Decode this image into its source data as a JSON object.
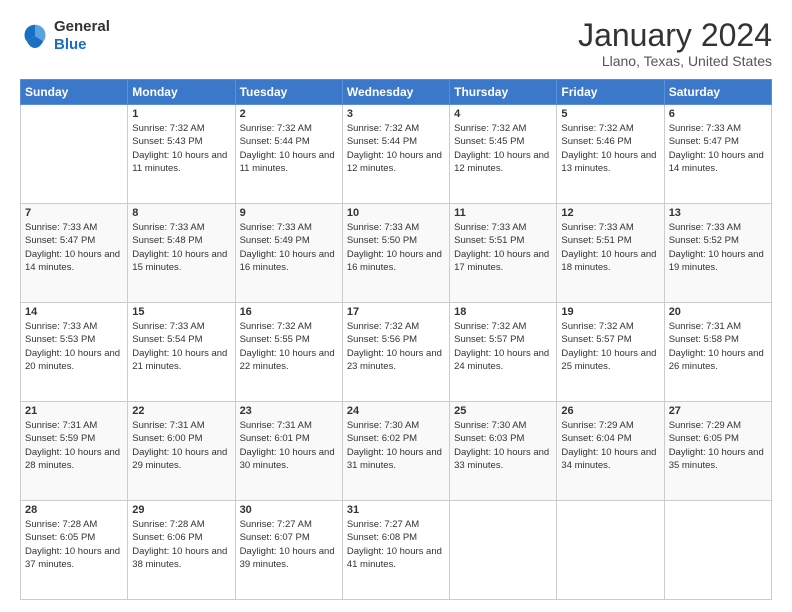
{
  "header": {
    "logo": {
      "general": "General",
      "blue": "Blue"
    },
    "title": "January 2024",
    "location": "Llano, Texas, United States"
  },
  "days_of_week": [
    "Sunday",
    "Monday",
    "Tuesday",
    "Wednesday",
    "Thursday",
    "Friday",
    "Saturday"
  ],
  "weeks": [
    [
      {
        "day": "",
        "sunrise": "",
        "sunset": "",
        "daylight": ""
      },
      {
        "day": "1",
        "sunrise": "Sunrise: 7:32 AM",
        "sunset": "Sunset: 5:43 PM",
        "daylight": "Daylight: 10 hours and 11 minutes."
      },
      {
        "day": "2",
        "sunrise": "Sunrise: 7:32 AM",
        "sunset": "Sunset: 5:44 PM",
        "daylight": "Daylight: 10 hours and 11 minutes."
      },
      {
        "day": "3",
        "sunrise": "Sunrise: 7:32 AM",
        "sunset": "Sunset: 5:44 PM",
        "daylight": "Daylight: 10 hours and 12 minutes."
      },
      {
        "day": "4",
        "sunrise": "Sunrise: 7:32 AM",
        "sunset": "Sunset: 5:45 PM",
        "daylight": "Daylight: 10 hours and 12 minutes."
      },
      {
        "day": "5",
        "sunrise": "Sunrise: 7:32 AM",
        "sunset": "Sunset: 5:46 PM",
        "daylight": "Daylight: 10 hours and 13 minutes."
      },
      {
        "day": "6",
        "sunrise": "Sunrise: 7:33 AM",
        "sunset": "Sunset: 5:47 PM",
        "daylight": "Daylight: 10 hours and 14 minutes."
      }
    ],
    [
      {
        "day": "7",
        "sunrise": "Sunrise: 7:33 AM",
        "sunset": "Sunset: 5:47 PM",
        "daylight": "Daylight: 10 hours and 14 minutes."
      },
      {
        "day": "8",
        "sunrise": "Sunrise: 7:33 AM",
        "sunset": "Sunset: 5:48 PM",
        "daylight": "Daylight: 10 hours and 15 minutes."
      },
      {
        "day": "9",
        "sunrise": "Sunrise: 7:33 AM",
        "sunset": "Sunset: 5:49 PM",
        "daylight": "Daylight: 10 hours and 16 minutes."
      },
      {
        "day": "10",
        "sunrise": "Sunrise: 7:33 AM",
        "sunset": "Sunset: 5:50 PM",
        "daylight": "Daylight: 10 hours and 16 minutes."
      },
      {
        "day": "11",
        "sunrise": "Sunrise: 7:33 AM",
        "sunset": "Sunset: 5:51 PM",
        "daylight": "Daylight: 10 hours and 17 minutes."
      },
      {
        "day": "12",
        "sunrise": "Sunrise: 7:33 AM",
        "sunset": "Sunset: 5:51 PM",
        "daylight": "Daylight: 10 hours and 18 minutes."
      },
      {
        "day": "13",
        "sunrise": "Sunrise: 7:33 AM",
        "sunset": "Sunset: 5:52 PM",
        "daylight": "Daylight: 10 hours and 19 minutes."
      }
    ],
    [
      {
        "day": "14",
        "sunrise": "Sunrise: 7:33 AM",
        "sunset": "Sunset: 5:53 PM",
        "daylight": "Daylight: 10 hours and 20 minutes."
      },
      {
        "day": "15",
        "sunrise": "Sunrise: 7:33 AM",
        "sunset": "Sunset: 5:54 PM",
        "daylight": "Daylight: 10 hours and 21 minutes."
      },
      {
        "day": "16",
        "sunrise": "Sunrise: 7:32 AM",
        "sunset": "Sunset: 5:55 PM",
        "daylight": "Daylight: 10 hours and 22 minutes."
      },
      {
        "day": "17",
        "sunrise": "Sunrise: 7:32 AM",
        "sunset": "Sunset: 5:56 PM",
        "daylight": "Daylight: 10 hours and 23 minutes."
      },
      {
        "day": "18",
        "sunrise": "Sunrise: 7:32 AM",
        "sunset": "Sunset: 5:57 PM",
        "daylight": "Daylight: 10 hours and 24 minutes."
      },
      {
        "day": "19",
        "sunrise": "Sunrise: 7:32 AM",
        "sunset": "Sunset: 5:57 PM",
        "daylight": "Daylight: 10 hours and 25 minutes."
      },
      {
        "day": "20",
        "sunrise": "Sunrise: 7:31 AM",
        "sunset": "Sunset: 5:58 PM",
        "daylight": "Daylight: 10 hours and 26 minutes."
      }
    ],
    [
      {
        "day": "21",
        "sunrise": "Sunrise: 7:31 AM",
        "sunset": "Sunset: 5:59 PM",
        "daylight": "Daylight: 10 hours and 28 minutes."
      },
      {
        "day": "22",
        "sunrise": "Sunrise: 7:31 AM",
        "sunset": "Sunset: 6:00 PM",
        "daylight": "Daylight: 10 hours and 29 minutes."
      },
      {
        "day": "23",
        "sunrise": "Sunrise: 7:31 AM",
        "sunset": "Sunset: 6:01 PM",
        "daylight": "Daylight: 10 hours and 30 minutes."
      },
      {
        "day": "24",
        "sunrise": "Sunrise: 7:30 AM",
        "sunset": "Sunset: 6:02 PM",
        "daylight": "Daylight: 10 hours and 31 minutes."
      },
      {
        "day": "25",
        "sunrise": "Sunrise: 7:30 AM",
        "sunset": "Sunset: 6:03 PM",
        "daylight": "Daylight: 10 hours and 33 minutes."
      },
      {
        "day": "26",
        "sunrise": "Sunrise: 7:29 AM",
        "sunset": "Sunset: 6:04 PM",
        "daylight": "Daylight: 10 hours and 34 minutes."
      },
      {
        "day": "27",
        "sunrise": "Sunrise: 7:29 AM",
        "sunset": "Sunset: 6:05 PM",
        "daylight": "Daylight: 10 hours and 35 minutes."
      }
    ],
    [
      {
        "day": "28",
        "sunrise": "Sunrise: 7:28 AM",
        "sunset": "Sunset: 6:05 PM",
        "daylight": "Daylight: 10 hours and 37 minutes."
      },
      {
        "day": "29",
        "sunrise": "Sunrise: 7:28 AM",
        "sunset": "Sunset: 6:06 PM",
        "daylight": "Daylight: 10 hours and 38 minutes."
      },
      {
        "day": "30",
        "sunrise": "Sunrise: 7:27 AM",
        "sunset": "Sunset: 6:07 PM",
        "daylight": "Daylight: 10 hours and 39 minutes."
      },
      {
        "day": "31",
        "sunrise": "Sunrise: 7:27 AM",
        "sunset": "Sunset: 6:08 PM",
        "daylight": "Daylight: 10 hours and 41 minutes."
      },
      {
        "day": "",
        "sunrise": "",
        "sunset": "",
        "daylight": ""
      },
      {
        "day": "",
        "sunrise": "",
        "sunset": "",
        "daylight": ""
      },
      {
        "day": "",
        "sunrise": "",
        "sunset": "",
        "daylight": ""
      }
    ]
  ]
}
